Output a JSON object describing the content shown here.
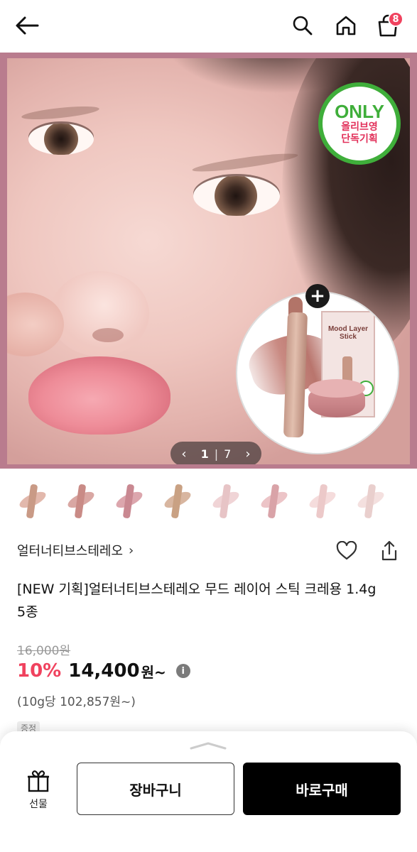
{
  "header": {
    "back_icon": "back-arrow-icon",
    "search_icon": "search-icon",
    "home_icon": "home-icon",
    "cart_icon": "cart-icon",
    "cart_count": "8",
    "badge_color": "#f0425e"
  },
  "hero": {
    "only_title": "ONLY",
    "only_line1": "올리브영",
    "only_line2": "단독기획",
    "product_box_title": "Mood Layer Stick",
    "plus_label": "+",
    "pager_current": "1",
    "pager_sep": "|",
    "pager_total": "7",
    "pager_prev": "‹",
    "pager_next": "›",
    "frame_color": "#b97c8e"
  },
  "thumbnails": [
    {
      "stick": "#c99a86",
      "smear": "#e2b8ac"
    },
    {
      "stick": "#c98b86",
      "smear": "#d9a7a3"
    },
    {
      "stick": "#c98891",
      "smear": "#dca6ad"
    },
    {
      "stick": "#c9a183",
      "smear": "#d8b6a0"
    },
    {
      "stick": "#e7c4c6",
      "smear": "#f0d4d6"
    },
    {
      "stick": "#d9a3a8",
      "smear": "#ecc4c7"
    },
    {
      "stick": "#ecc9c9",
      "smear": "#f5dcdc"
    },
    {
      "stick": "#e9cfcd",
      "smear": "#f4e0df"
    }
  ],
  "product": {
    "brand": "얼터너티브스테레오",
    "brand_chevron": "›",
    "title": "[NEW 기획]얼터너티브스테레오 무드 레이어 스틱 크레용 1.4g 5종",
    "original_price": "16,000원",
    "discount": "10%",
    "sale_price": "14,400",
    "sale_unit": "원~",
    "info_label": "i",
    "unit_price": "(10g당 102,857원~)",
    "gift_tag": "증정",
    "accent_color": "#f0425e"
  },
  "bottom_bar": {
    "gift_label": "선물",
    "cart_label": "장바구니",
    "buy_label": "바로구매"
  }
}
